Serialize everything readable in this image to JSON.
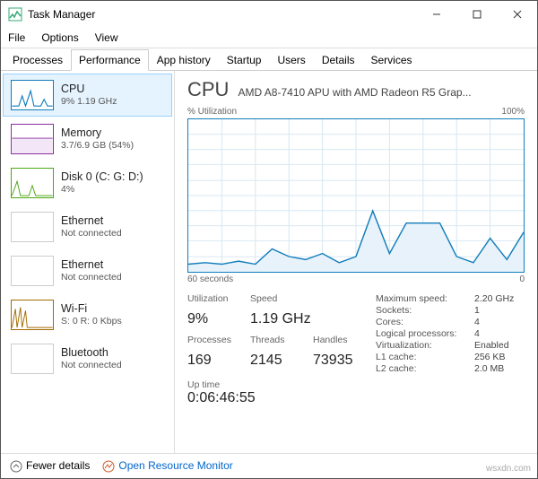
{
  "window": {
    "title": "Task Manager"
  },
  "menu": {
    "file": "File",
    "options": "Options",
    "view": "View"
  },
  "tabs": {
    "processes": "Processes",
    "performance": "Performance",
    "apphistory": "App history",
    "startup": "Startup",
    "users": "Users",
    "details": "Details",
    "services": "Services"
  },
  "sidebar": {
    "cpu": {
      "title": "CPU",
      "sub": "9%  1.19 GHz"
    },
    "memory": {
      "title": "Memory",
      "sub": "3.7/6.9 GB (54%)"
    },
    "disk": {
      "title": "Disk 0 (C: G: D:)",
      "sub": "4%"
    },
    "eth0": {
      "title": "Ethernet",
      "sub": "Not connected"
    },
    "eth1": {
      "title": "Ethernet",
      "sub": "Not connected"
    },
    "wifi": {
      "title": "Wi-Fi",
      "sub": "S: 0  R: 0 Kbps"
    },
    "bt": {
      "title": "Bluetooth",
      "sub": "Not connected"
    }
  },
  "main": {
    "heading": "CPU",
    "cpu_name": "AMD A8-7410 APU with AMD Radeon R5 Grap...",
    "chart_top_left": "% Utilization",
    "chart_top_right": "100%",
    "chart_bottom_left": "60 seconds",
    "chart_bottom_right": "0",
    "stats": {
      "utilization_l": "Utilization",
      "utilization_v": "9%",
      "speed_l": "Speed",
      "speed_v": "1.19 GHz",
      "processes_l": "Processes",
      "processes_v": "169",
      "threads_l": "Threads",
      "threads_v": "2145",
      "handles_l": "Handles",
      "handles_v": "73935",
      "uptime_l": "Up time",
      "uptime_v": "0:06:46:55"
    },
    "info": {
      "maxspeed_l": "Maximum speed:",
      "maxspeed_v": "2.20 GHz",
      "sockets_l": "Sockets:",
      "sockets_v": "1",
      "cores_l": "Cores:",
      "cores_v": "4",
      "lproc_l": "Logical processors:",
      "lproc_v": "4",
      "virt_l": "Virtualization:",
      "virt_v": "Enabled",
      "l1_l": "L1 cache:",
      "l1_v": "256 KB",
      "l2_l": "L2 cache:",
      "l2_v": "2.0 MB"
    }
  },
  "footer": {
    "fewer": "Fewer details",
    "resmon": "Open Resource Monitor"
  },
  "watermark": "wsxdn.com",
  "chart_data": {
    "type": "line",
    "title": "% Utilization",
    "xlabel": "60 seconds",
    "ylabel": "",
    "xlim": [
      60,
      0
    ],
    "ylim": [
      0,
      100
    ],
    "x_seconds_ago": [
      60,
      57,
      54,
      51,
      48,
      45,
      42,
      39,
      36,
      33,
      30,
      27,
      24,
      21,
      18,
      15,
      12,
      9,
      6,
      3,
      0
    ],
    "values": [
      5,
      6,
      5,
      7,
      5,
      15,
      10,
      8,
      12,
      6,
      10,
      40,
      12,
      32,
      32,
      32,
      10,
      6,
      22,
      8,
      26
    ]
  }
}
